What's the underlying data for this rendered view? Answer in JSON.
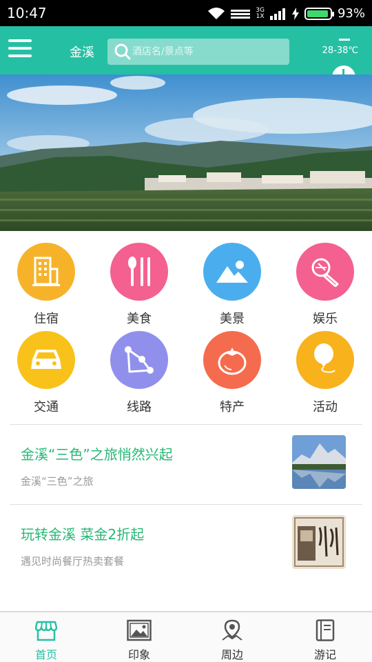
{
  "status_bar": {
    "time": "10:47",
    "network_top": "3G",
    "network_bottom": "1X",
    "battery": "93%",
    "battery_level": 0.93
  },
  "header": {
    "city": "金溪",
    "search_placeholder": "酒店名/景点等",
    "weather_temp": "28-38℃",
    "accent_color": "#25c0a4"
  },
  "categories": [
    {
      "label": "住宿",
      "icon": "building-icon",
      "color": "#f6b32a"
    },
    {
      "label": "美食",
      "icon": "spoon-fork-icon",
      "color": "#f4608f"
    },
    {
      "label": "美景",
      "icon": "landscape-icon",
      "color": "#4aaeee"
    },
    {
      "label": "娱乐",
      "icon": "microphone-icon",
      "color": "#f4608f"
    },
    {
      "label": "交通",
      "icon": "car-icon",
      "color": "#f8c21a"
    },
    {
      "label": "线路",
      "icon": "route-icon",
      "color": "#9090ec"
    },
    {
      "label": "特产",
      "icon": "tomato-icon",
      "color": "#f56b4e"
    },
    {
      "label": "活动",
      "icon": "balloon-icon",
      "color": "#f8b21c"
    }
  ],
  "articles": [
    {
      "title": "金溪“三色”之旅悄然兴起",
      "subtitle": "金溪“三色”之旅",
      "thumb": "mountain-lake-thumbnail"
    },
    {
      "title": "玩转金溪 菜金2折起",
      "subtitle": "遇见时尚餐厅热卖套餐",
      "thumb": "restaurant-calligraphy-thumbnail"
    }
  ],
  "bottom_nav": [
    {
      "label": "首页",
      "icon": "home-shop-icon",
      "active": true
    },
    {
      "label": "印象",
      "icon": "picture-icon",
      "active": false
    },
    {
      "label": "周边",
      "icon": "map-pin-icon",
      "active": false
    },
    {
      "label": "游记",
      "icon": "notebook-icon",
      "active": false
    }
  ]
}
